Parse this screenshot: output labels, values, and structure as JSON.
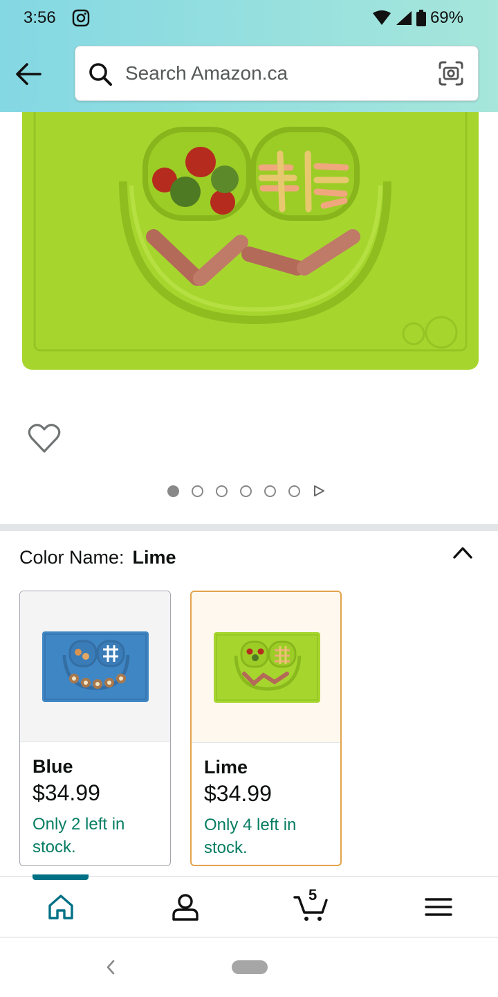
{
  "status_bar": {
    "time": "3:56",
    "battery": "69%"
  },
  "search": {
    "placeholder": "Search Amazon.ca"
  },
  "product": {
    "image_count": 6,
    "current_image": 1
  },
  "color_selector": {
    "label": "Color Name:",
    "selected": "Lime",
    "options": [
      {
        "name": "Blue",
        "price": "$34.99",
        "stock": "Only 2 left in stock.",
        "selected": false,
        "color": "#3f86c4"
      },
      {
        "name": "Lime",
        "price": "$34.99",
        "stock": "Only 4 left in stock.",
        "selected": true,
        "color": "#a6d62e"
      }
    ]
  },
  "bottom_nav": {
    "cart_count": "5",
    "items": [
      "home-icon",
      "account-icon",
      "cart-icon",
      "menu-icon"
    ]
  },
  "colors": {
    "accent_teal": "#007185",
    "stock_green": "#067d62",
    "selected_border": "#e3a34a",
    "header_gradient": [
      "#84d8e3",
      "#a6e6db"
    ]
  }
}
